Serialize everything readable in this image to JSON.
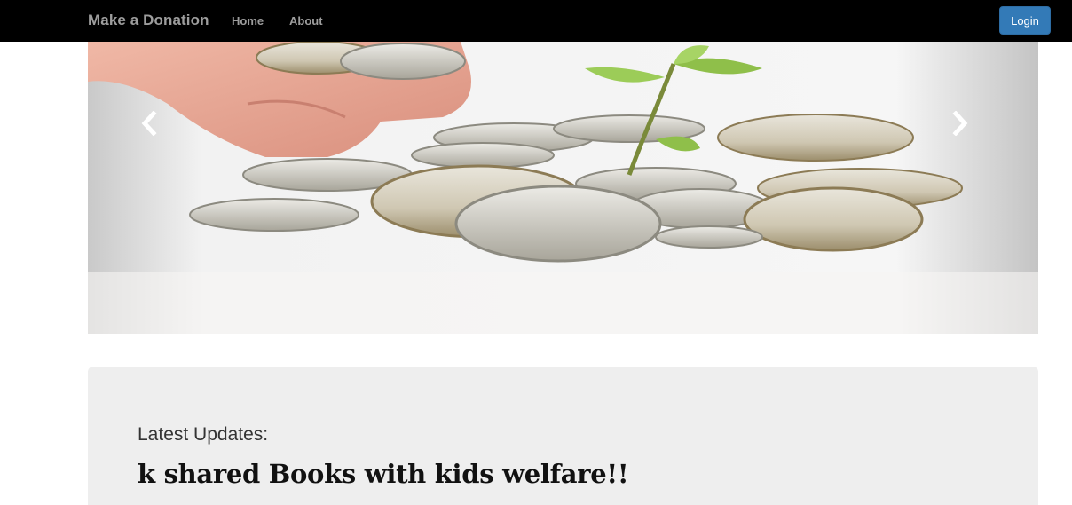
{
  "navbar": {
    "brand": "Make a Donation",
    "links": [
      {
        "label": "Home"
      },
      {
        "label": "About"
      }
    ],
    "login_label": "Login",
    "background": "#000000",
    "link_color": "#9d9d9d",
    "login_color": "#337ab7"
  },
  "carousel": {
    "image": "coins-with-sprouting-plant",
    "prev_icon": "chevron-left-icon",
    "next_icon": "chevron-right-icon"
  },
  "updates": {
    "label": "Latest Updates:",
    "headline": "k shared Books with kids welfare!!",
    "background": "#eeeeee"
  }
}
